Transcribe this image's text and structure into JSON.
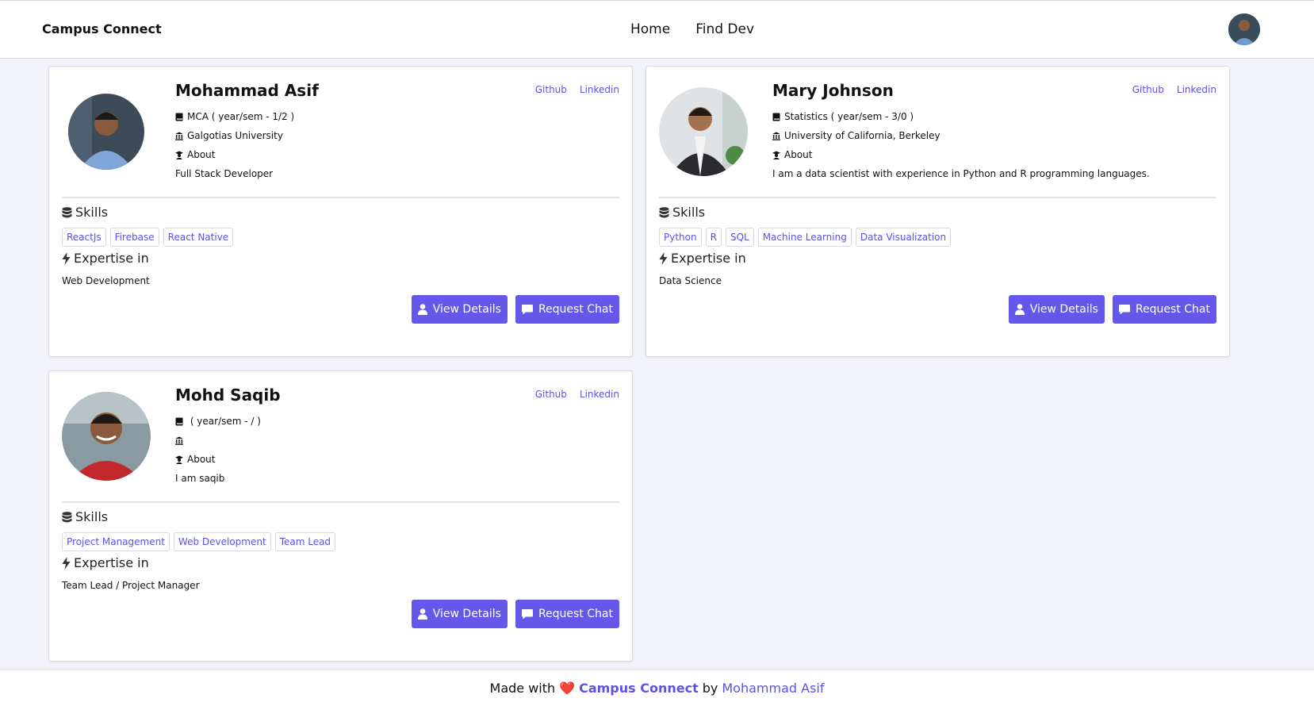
{
  "nav": {
    "brand": "Campus Connect",
    "links": [
      "Home",
      "Find Dev"
    ]
  },
  "labels": {
    "github": "Github",
    "linkedin": "Linkedin",
    "about": "About",
    "skills": "Skills",
    "expertise": "Expertise in",
    "view_details": "View Details",
    "request_chat": "Request Chat"
  },
  "cards": [
    {
      "name": "Mohammad Asif",
      "course": "MCA ( year/sem - 1/2 )",
      "university": "Galgotias University",
      "bio": "Full Stack Developer",
      "skills": [
        "ReactJs",
        "Firebase",
        "React Native"
      ],
      "expertise": "Web Development"
    },
    {
      "name": "Mary Johnson",
      "course": "Statistics ( year/sem - 3/0 )",
      "university": "University of California, Berkeley",
      "bio": "I am a data scientist with experience in Python and R programming languages.",
      "skills": [
        "Python",
        "R",
        "SQL",
        "Machine Learning",
        "Data Visualization"
      ],
      "expertise": "Data Science"
    },
    {
      "name": "Mohd Saqib",
      "course": " ( year/sem - / )",
      "university": "",
      "bio": "I am saqib",
      "skills": [
        "Project Management",
        "Web Development",
        "Team Lead"
      ],
      "expertise": "Team Lead / Project Manager"
    }
  ],
  "footer": {
    "prefix": "Made with",
    "heart": "❤️",
    "brand": "Campus Connect",
    "by": "by",
    "author": "Mohammad Asif"
  },
  "colors": {
    "accent": "#6358ea",
    "link": "#5b52e6",
    "background": "#f3f4fb"
  }
}
